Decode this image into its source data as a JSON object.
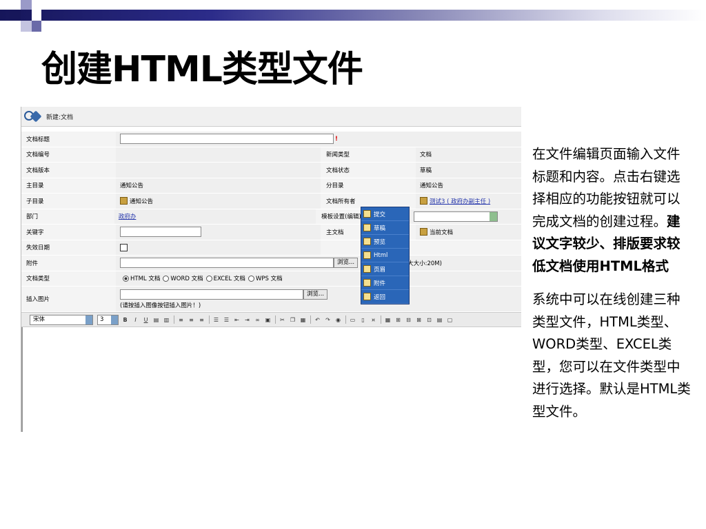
{
  "title": "创建HTML类型文件",
  "screenshot": {
    "header": "新建:文档",
    "rows": [
      {
        "label": "文档标题",
        "value": "",
        "required_mark": "!"
      },
      {
        "label": "文档编号",
        "value": "",
        "label2": "新闻类型",
        "value2": "文档"
      },
      {
        "label": "文档版本",
        "value": "",
        "label2": "文档状态",
        "value2": "草稿"
      },
      {
        "label": "主目录",
        "value": "通知公告",
        "label2": "分目录",
        "value2": "通知公告"
      },
      {
        "label": "子目录",
        "value": "通知公告",
        "label2": "文档所有者",
        "value2": "测试3 ( 政府办副主任 )"
      },
      {
        "label": "部门",
        "value": "政府办",
        "label2": "模板设置(编辑)",
        "value2": ""
      },
      {
        "label": "关键字",
        "value": "",
        "label2": "主文档",
        "value2": "当前文档"
      },
      {
        "label": "失效日期",
        "value": ""
      },
      {
        "label": "附件",
        "browse": "浏览...",
        "note": "大大小:20M)"
      },
      {
        "label": "文档类型",
        "options": [
          "HTML 文档",
          "WORD 文档",
          "EXCEL 文档",
          "WPS 文档"
        ]
      },
      {
        "label": "插入图片",
        "browse": "浏览...",
        "note": "(请按插入图像按钮插入图片！)"
      }
    ],
    "toolbar": {
      "font": "宋体",
      "size": "3",
      "bold": "B",
      "italic": "I",
      "underline": "U"
    },
    "popup_menu": [
      "提交",
      "草稿",
      "预览",
      "Html",
      "页眉",
      "附件",
      "返回"
    ]
  },
  "description": {
    "p1_normal": "在文件编辑页面输入文件标题和内容。点击右键选择相应的功能按钮就可以完成文档的创建过程。",
    "p1_bold": "建议文字较少、排版要求较低文档使用HTML格式",
    "p2": "系统中可以在线创建三种类型文件，HTML类型、WORD类型、EXCEL类型，您可以在文件类型中进行选择。默认是HTML类型文件。"
  }
}
